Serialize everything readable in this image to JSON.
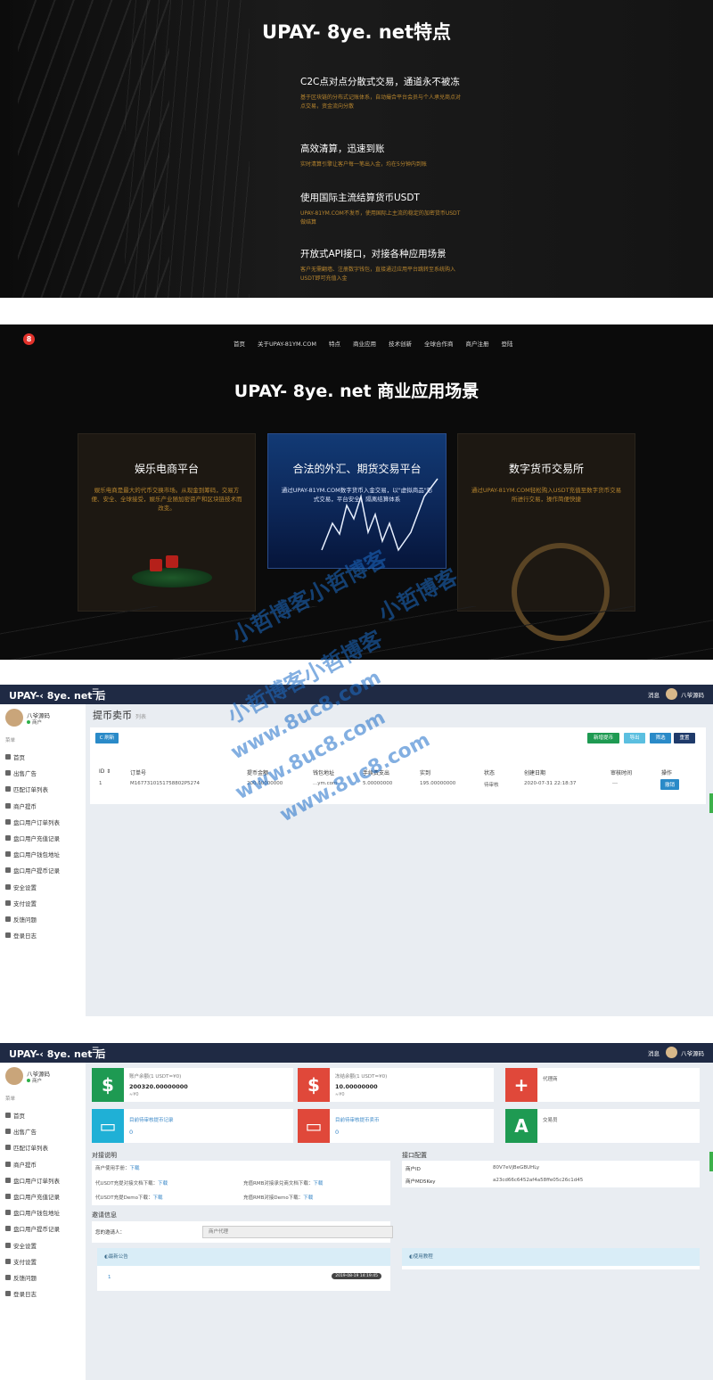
{
  "features_section": {
    "title": "UPAY- 8ye. net特点",
    "items": [
      {
        "title": "C2C点对点分散式交易，通道永不被冻",
        "desc": "基于区块链的分布式记账体系，自动撮合平台会员与个人承兑商点对点交易，资金流向分散"
      },
      {
        "title": "高效清算，迅速到账",
        "desc": "实时清算引擎让客户每一笔出入金，均在5分钟内到账"
      },
      {
        "title": "使用国际主流结算货币USDT",
        "desc": "UPAY-81YM.COM不发币，使用国际上主流的稳定的加密货币USDT做结算"
      },
      {
        "title": "开放式API接口，对接各种应用场景",
        "desc": "客户无需翻墙、注册数字钱包，直接通过应用平台跳转至系统购入USDT即可充值入金"
      }
    ]
  },
  "business_section": {
    "logo_text": "8",
    "nav": [
      "首页",
      "关于UPAY-81YM.COM",
      "特点",
      "商业应用",
      "技术创新",
      "全球合作商",
      "商户注册",
      "登陆"
    ],
    "title": "UPAY- 8ye. net 商业应用场景",
    "cards": [
      {
        "title": "娱乐电商平台",
        "desc": "娱乐电商是最大的代币交换市场。从现金到筹码，交易方便、安全、全球接受，娱乐产业随加密资产和区块链技术而改变。"
      },
      {
        "title": "合法的外汇、期货交易平台",
        "desc": "通过UPAY-81YM.COM数字货币入金交易，以\"虚拟商品\"形式交易，平台安全，隔离结算体系"
      },
      {
        "title": "数字货币交易所",
        "desc": "通过UPAY-81YM.COM轻松购入USDT充值至数字货币交易所进行交易，操作简便快捷"
      }
    ]
  },
  "admin_common": {
    "brand": "UPAY-‹ 8ye. net 后",
    "menu_icon": "☰",
    "messages": "消息",
    "user_name": "八爷源码",
    "side_user": "八爷源码",
    "side_status": "商户",
    "side_header": "菜单",
    "menu": [
      "首页",
      "出售广告",
      "匹配订单列表",
      "商户提币",
      "盘口用户订单列表",
      "盘口用户充值记录",
      "盘口用户钱包地址",
      "盘口用户提币记录",
      "安全设置",
      "支付设置",
      "反馈问题",
      "登录日志"
    ]
  },
  "withdraw_page": {
    "title": "提币卖币",
    "subtitle": "列表",
    "refresh_btn": "C 刷新",
    "right_btns": [
      "新增提币",
      "导出",
      "筛选",
      "重置"
    ],
    "columns": [
      "ID ⇕",
      "订单号",
      "提币金额",
      "钱包地址",
      "手续费支出",
      "实到",
      "状态",
      "创建日期",
      "审核时间",
      "操作"
    ],
    "rows": [
      {
        "id": "1",
        "order": "M1677310151758802P5274",
        "amount": "200.00000000",
        "address": "...ym.com",
        "fee": "5.00000000",
        "actual": "195.00000000",
        "status": "待审核",
        "created": "2020-07-31 22:18:37",
        "reviewed": "---",
        "op": "撤销"
      }
    ]
  },
  "dashboard_page": {
    "stats": [
      {
        "label": "账户余额(1 USDT=¥0)",
        "value": "200320.00000000",
        "sub": "≈¥0",
        "icon": "$",
        "color": "#1e9a52"
      },
      {
        "label": "冻结余额(1 USDT=¥0)",
        "value": "10.00000000",
        "sub": "≈¥0",
        "icon": "$",
        "color": "#e0483a"
      },
      {
        "label": "代理商",
        "value": "",
        "sub": "",
        "icon": "+",
        "color": "#e0483a"
      },
      {
        "label": "目前待审核提币记录",
        "value": "0",
        "sub": "",
        "icon": "▭",
        "color": "#1fb0d6"
      },
      {
        "label": "目前待审核提币卖币",
        "value": "0",
        "sub": "",
        "icon": "▭",
        "color": "#e0483a"
      },
      {
        "label": "交易员",
        "value": "",
        "sub": "",
        "icon": "A",
        "color": "#1e9a52"
      }
    ],
    "docking_title": "对接说明",
    "docking": [
      {
        "text": "商户使用手册：",
        "link": "下载"
      },
      {
        "text": "代USDT充提对接文档下载：",
        "link": "下载"
      },
      {
        "text": "充值RMB对接承兑商文档下载：",
        "link": "下载"
      },
      {
        "text": "代USDT充提Demo下载：",
        "link": "下载"
      },
      {
        "text": "充值RMB对接Demo下载：",
        "link": "下载"
      }
    ],
    "api_title": "接口配置",
    "api": [
      {
        "key": "商户ID",
        "value": "80V7eVjBeGBUHLy"
      },
      {
        "key": "商户MD5Key",
        "value": "a23cd66c6452af4a58ffe05c26c1d45"
      }
    ],
    "invite_title": "邀请信息",
    "invite_label": "您的邀请人：",
    "invite_value": "商户代理",
    "notice_title": "◐最新公告",
    "notice_item": "1",
    "notice_time": "2019-08-19 14:19:45",
    "tutorial_title": "◐使用教程"
  },
  "watermark": {
    "line1": "小哲博客小哲博客",
    "line2": "小哲博客",
    "line3": "小哲博客小哲博客",
    "url": "www.8uc8.com"
  }
}
